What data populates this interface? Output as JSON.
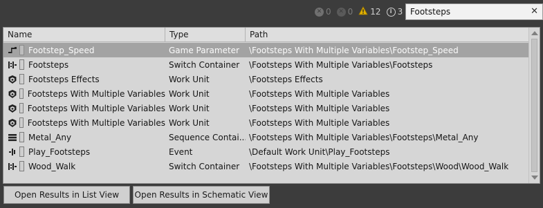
{
  "status": {
    "errors_icon": "error-icon",
    "errors_count": "0",
    "blocked_icon": "blocked-icon",
    "blocked_count": "0",
    "warnings_icon": "warning-icon",
    "warnings_count": "12",
    "info_icon": "info-icon",
    "info_count": "3"
  },
  "search": {
    "value": "Footsteps",
    "clear_label": "✕"
  },
  "table": {
    "columns": [
      "Name",
      "Type",
      "Path"
    ],
    "rows": [
      {
        "icon": "game-parameter-icon",
        "name": "Footstep_Speed",
        "type": "Game Parameter",
        "path": "\\Footsteps With Multiple Variables\\Footstep_Speed",
        "selected": true
      },
      {
        "icon": "switch-container-icon",
        "name": "Footsteps",
        "type": "Switch Container",
        "path": "\\Footsteps With Multiple Variables\\Footsteps",
        "selected": false
      },
      {
        "icon": "work-unit-icon",
        "name": "Footsteps Effects",
        "type": "Work Unit",
        "path": "\\Footsteps Effects",
        "selected": false
      },
      {
        "icon": "work-unit-icon",
        "name": "Footsteps With Multiple Variables",
        "type": "Work Unit",
        "path": "\\Footsteps With Multiple Variables",
        "selected": false
      },
      {
        "icon": "work-unit-icon",
        "name": "Footsteps With Multiple Variables",
        "type": "Work Unit",
        "path": "\\Footsteps With Multiple Variables",
        "selected": false
      },
      {
        "icon": "work-unit-icon",
        "name": "Footsteps With Multiple Variables",
        "type": "Work Unit",
        "path": "\\Footsteps With Multiple Variables",
        "selected": false
      },
      {
        "icon": "sequence-container-icon",
        "name": "Metal_Any",
        "type": "Sequence Contai...",
        "path": "\\Footsteps With Multiple Variables\\Footsteps\\Metal_Any",
        "selected": false
      },
      {
        "icon": "event-icon",
        "name": "Play_Footsteps",
        "type": "Event",
        "path": "\\Default Work Unit\\Play_Footsteps",
        "selected": false
      },
      {
        "icon": "switch-container-icon",
        "name": "Wood_Walk",
        "type": "Switch Container",
        "path": "\\Footsteps With Multiple Variables\\Footsteps\\Wood\\Wood_Walk",
        "selected": false
      }
    ]
  },
  "buttons": {
    "list_view": "Open Results in List View",
    "schematic_view": "Open Results in Schematic View"
  },
  "colors": {
    "background": "#3c3c3c",
    "panel": "#d6d6d6",
    "selected_row": "#a3a3a3",
    "warning": "#e0b000"
  }
}
